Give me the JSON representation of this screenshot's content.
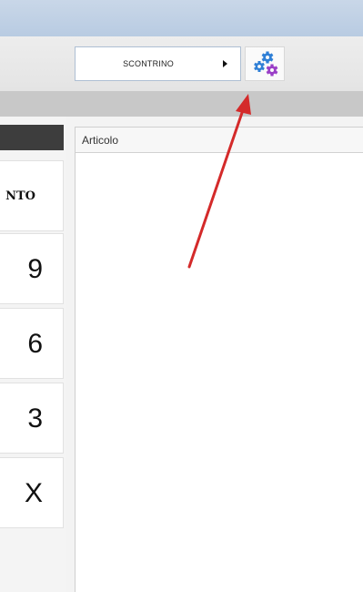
{
  "toolbar": {
    "receipt_label": "SCONTRINO",
    "receipt_arrow_icon": "play-icon",
    "settings_icon": "gears-icon"
  },
  "keypad": {
    "keys": [
      {
        "label": "NTO",
        "kind": "label"
      },
      {
        "label": "9",
        "kind": "digit"
      },
      {
        "label": "6",
        "kind": "digit"
      },
      {
        "label": "3",
        "kind": "digit"
      },
      {
        "label": "X",
        "kind": "digit"
      }
    ]
  },
  "grid": {
    "columns": [
      "Articolo"
    ]
  },
  "colors": {
    "arrow": "#d42a2a",
    "gear_blue": "#2f7fd6",
    "gear_purple": "#9a3fc7",
    "button_border": "#aebfd3"
  }
}
